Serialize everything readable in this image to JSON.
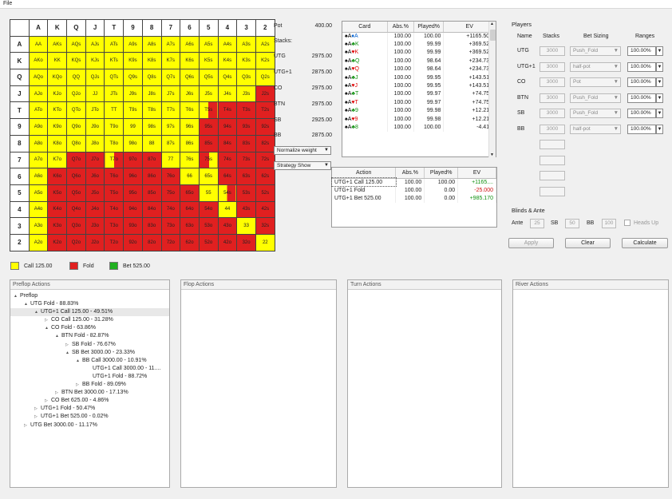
{
  "menu": {
    "file": "File"
  },
  "grid": {
    "col_headers": [
      "A",
      "K",
      "Q",
      "J",
      "T",
      "9",
      "8",
      "7",
      "6",
      "5",
      "4",
      "3",
      "2"
    ],
    "rows": [
      {
        "h": "A",
        "cells": [
          [
            "AA",
            "y"
          ],
          [
            "AKs",
            "y"
          ],
          [
            "AQs",
            "y"
          ],
          [
            "AJs",
            "y"
          ],
          [
            "ATs",
            "y"
          ],
          [
            "A9s",
            "y"
          ],
          [
            "A8s",
            "y"
          ],
          [
            "A7s",
            "y"
          ],
          [
            "A6s",
            "y"
          ],
          [
            "A5s",
            "y"
          ],
          [
            "A4s",
            "y"
          ],
          [
            "A3s",
            "y"
          ],
          [
            "A2s",
            "y"
          ]
        ]
      },
      {
        "h": "K",
        "cells": [
          [
            "AKo",
            "y"
          ],
          [
            "KK",
            "y"
          ],
          [
            "KQs",
            "y"
          ],
          [
            "KJs",
            "y"
          ],
          [
            "KTs",
            "y"
          ],
          [
            "K9s",
            "y"
          ],
          [
            "K8s",
            "y"
          ],
          [
            "K7s",
            "y"
          ],
          [
            "K6s",
            "y"
          ],
          [
            "K5s",
            "y"
          ],
          [
            "K4s",
            "y"
          ],
          [
            "K3s",
            "y"
          ],
          [
            "K2s",
            "y"
          ]
        ]
      },
      {
        "h": "Q",
        "cells": [
          [
            "AQo",
            "y"
          ],
          [
            "KQo",
            "y"
          ],
          [
            "QQ",
            "y"
          ],
          [
            "QJs",
            "y"
          ],
          [
            "QTs",
            "y"
          ],
          [
            "Q9s",
            "y"
          ],
          [
            "Q8s",
            "y"
          ],
          [
            "Q7s",
            "y"
          ],
          [
            "Q6s",
            "y"
          ],
          [
            "Q5s",
            "y"
          ],
          [
            "Q4s",
            "y"
          ],
          [
            "Q3s",
            "y"
          ],
          [
            "Q2s",
            "y"
          ]
        ]
      },
      {
        "h": "J",
        "cells": [
          [
            "AJo",
            "y"
          ],
          [
            "KJo",
            "y"
          ],
          [
            "QJo",
            "y"
          ],
          [
            "JJ",
            "y"
          ],
          [
            "JTs",
            "y"
          ],
          [
            "J9s",
            "y"
          ],
          [
            "J8s",
            "y"
          ],
          [
            "J7s",
            "y"
          ],
          [
            "J6s",
            "y"
          ],
          [
            "J5s",
            "y"
          ],
          [
            "J4s",
            "y"
          ],
          [
            "J3s",
            "y"
          ],
          [
            "J2s",
            "r"
          ]
        ]
      },
      {
        "h": "T",
        "cells": [
          [
            "ATo",
            "y"
          ],
          [
            "KTo",
            "y"
          ],
          [
            "QTo",
            "y"
          ],
          [
            "JTo",
            "y"
          ],
          [
            "TT",
            "y"
          ],
          [
            "T9s",
            "y"
          ],
          [
            "T8s",
            "y"
          ],
          [
            "T7s",
            "y"
          ],
          [
            "T6s",
            "y"
          ],
          [
            "T5s",
            "yr"
          ],
          [
            "T4s",
            "r"
          ],
          [
            "T3s",
            "r"
          ],
          [
            "T2s",
            "r"
          ]
        ]
      },
      {
        "h": "9",
        "cells": [
          [
            "A9o",
            "y"
          ],
          [
            "K9o",
            "y"
          ],
          [
            "Q9o",
            "y"
          ],
          [
            "J9o",
            "y"
          ],
          [
            "T9o",
            "y"
          ],
          [
            "99",
            "y"
          ],
          [
            "98s",
            "y"
          ],
          [
            "97s",
            "y"
          ],
          [
            "96s",
            "y"
          ],
          [
            "95s",
            "r"
          ],
          [
            "94s",
            "r"
          ],
          [
            "93s",
            "r"
          ],
          [
            "92s",
            "r"
          ]
        ]
      },
      {
        "h": "8",
        "cells": [
          [
            "A8o",
            "y"
          ],
          [
            "K8o",
            "y"
          ],
          [
            "Q8o",
            "y"
          ],
          [
            "J8o",
            "y"
          ],
          [
            "T8o",
            "y"
          ],
          [
            "98o",
            "y"
          ],
          [
            "88",
            "y"
          ],
          [
            "87s",
            "y"
          ],
          [
            "86s",
            "y"
          ],
          [
            "85s",
            "r"
          ],
          [
            "84s",
            "r"
          ],
          [
            "83s",
            "r"
          ],
          [
            "82s",
            "r"
          ]
        ]
      },
      {
        "h": "7",
        "cells": [
          [
            "A7o",
            "y"
          ],
          [
            "K7o",
            "y"
          ],
          [
            "Q7o",
            "r"
          ],
          [
            "J7o",
            "r"
          ],
          [
            "T7o",
            "yr"
          ],
          [
            "97o",
            "r"
          ],
          [
            "87o",
            "r"
          ],
          [
            "77",
            "y"
          ],
          [
            "76s",
            "y"
          ],
          [
            "75s",
            "ry"
          ],
          [
            "74s",
            "r"
          ],
          [
            "73s",
            "r"
          ],
          [
            "72s",
            "r"
          ]
        ]
      },
      {
        "h": "6",
        "cells": [
          [
            "A6o",
            "y"
          ],
          [
            "K6o",
            "r"
          ],
          [
            "Q6o",
            "r"
          ],
          [
            "J6o",
            "r"
          ],
          [
            "T6o",
            "r"
          ],
          [
            "96o",
            "r"
          ],
          [
            "86o",
            "r"
          ],
          [
            "76o",
            "r"
          ],
          [
            "66",
            "y"
          ],
          [
            "65s",
            "y"
          ],
          [
            "64s",
            "r"
          ],
          [
            "63s",
            "r"
          ],
          [
            "62s",
            "r"
          ]
        ]
      },
      {
        "h": "5",
        "cells": [
          [
            "A5o",
            "y"
          ],
          [
            "K5o",
            "r"
          ],
          [
            "Q5o",
            "r"
          ],
          [
            "J5o",
            "r"
          ],
          [
            "T5o",
            "r"
          ],
          [
            "95o",
            "r"
          ],
          [
            "85o",
            "r"
          ],
          [
            "75o",
            "r"
          ],
          [
            "65o",
            "r"
          ],
          [
            "55",
            "y"
          ],
          [
            "54s",
            "yr"
          ],
          [
            "53s",
            "r"
          ],
          [
            "52s",
            "r"
          ]
        ]
      },
      {
        "h": "4",
        "cells": [
          [
            "A4o",
            "y"
          ],
          [
            "K4o",
            "r"
          ],
          [
            "Q4o",
            "r"
          ],
          [
            "J4o",
            "r"
          ],
          [
            "T4o",
            "r"
          ],
          [
            "94o",
            "r"
          ],
          [
            "84o",
            "r"
          ],
          [
            "74o",
            "r"
          ],
          [
            "64o",
            "r"
          ],
          [
            "54o",
            "r"
          ],
          [
            "44",
            "y"
          ],
          [
            "43s",
            "r"
          ],
          [
            "42s",
            "r"
          ]
        ]
      },
      {
        "h": "3",
        "cells": [
          [
            "A3o",
            "y"
          ],
          [
            "K3o",
            "r"
          ],
          [
            "Q3o",
            "r"
          ],
          [
            "J3o",
            "r"
          ],
          [
            "T3o",
            "r"
          ],
          [
            "93o",
            "r"
          ],
          [
            "83o",
            "r"
          ],
          [
            "73o",
            "r"
          ],
          [
            "63o",
            "r"
          ],
          [
            "53o",
            "r"
          ],
          [
            "43o",
            "r"
          ],
          [
            "33",
            "y"
          ],
          [
            "32s",
            "r"
          ]
        ]
      },
      {
        "h": "2",
        "cells": [
          [
            "A2o",
            "y"
          ],
          [
            "K2o",
            "r"
          ],
          [
            "Q2o",
            "r"
          ],
          [
            "J2o",
            "r"
          ],
          [
            "T2o",
            "r"
          ],
          [
            "92o",
            "r"
          ],
          [
            "82o",
            "r"
          ],
          [
            "72o",
            "r"
          ],
          [
            "62o",
            "r"
          ],
          [
            "52o",
            "r"
          ],
          [
            "42o",
            "r"
          ],
          [
            "32o",
            "r"
          ],
          [
            "22",
            "y"
          ]
        ]
      }
    ]
  },
  "legend": [
    {
      "label": "Call 125.00",
      "color": "#ffff00"
    },
    {
      "label": "Fold",
      "color": "#e02020"
    },
    {
      "label": "Bet 525.00",
      "color": "#20b020"
    }
  ],
  "pot": {
    "label": "Pot",
    "value": "400.00"
  },
  "stacks": {
    "label": "Stacks:",
    "items": [
      {
        "pos": "UTG",
        "value": "2975.00"
      },
      {
        "pos": "UTG+1",
        "value": "2875.00"
      },
      {
        "pos": "CO",
        "value": "2975.00"
      },
      {
        "pos": "BTN",
        "value": "2975.00"
      },
      {
        "pos": "SB",
        "value": "2925.00"
      },
      {
        "pos": "BB",
        "value": "2875.00"
      }
    ]
  },
  "dropdowns": {
    "weight": "Normalize weight",
    "strategy": "Strategy Show"
  },
  "cards_table": {
    "headers": [
      "Card",
      "Abs.%",
      "Played%",
      "EV"
    ],
    "rows": [
      {
        "c1": "♠A",
        "s1": "s",
        "c2": "♦A",
        "s2": "d",
        "abs": "100.00",
        "played": "100.00",
        "ev": "+1165.505"
      },
      {
        "c1": "♠A",
        "s1": "s",
        "c2": "♣K",
        "s2": "c",
        "abs": "100.00",
        "played": "99.99",
        "ev": "+369.525"
      },
      {
        "c1": "♠A",
        "s1": "s",
        "c2": "♥K",
        "s2": "h",
        "abs": "100.00",
        "played": "99.99",
        "ev": "+369.525"
      },
      {
        "c1": "♠A",
        "s1": "s",
        "c2": "♣Q",
        "s2": "c",
        "abs": "100.00",
        "played": "98.64",
        "ev": "+234.733"
      },
      {
        "c1": "♠A",
        "s1": "s",
        "c2": "♥Q",
        "s2": "h",
        "abs": "100.00",
        "played": "98.64",
        "ev": "+234.733"
      },
      {
        "c1": "♠A",
        "s1": "s",
        "c2": "♣J",
        "s2": "c",
        "abs": "100.00",
        "played": "99.95",
        "ev": "+143.518"
      },
      {
        "c1": "♠A",
        "s1": "s",
        "c2": "♥J",
        "s2": "h",
        "abs": "100.00",
        "played": "99.95",
        "ev": "+143.518"
      },
      {
        "c1": "♠A",
        "s1": "s",
        "c2": "♣T",
        "s2": "c",
        "abs": "100.00",
        "played": "99.97",
        "ev": "+74.757"
      },
      {
        "c1": "♠A",
        "s1": "s",
        "c2": "♥T",
        "s2": "h",
        "abs": "100.00",
        "played": "99.97",
        "ev": "+74.757"
      },
      {
        "c1": "♠A",
        "s1": "s",
        "c2": "♣9",
        "s2": "c",
        "abs": "100.00",
        "played": "99.98",
        "ev": "+12.217"
      },
      {
        "c1": "♠A",
        "s1": "s",
        "c2": "♥9",
        "s2": "h",
        "abs": "100.00",
        "played": "99.98",
        "ev": "+12.217"
      },
      {
        "c1": "♠A",
        "s1": "s",
        "c2": "♣8",
        "s2": "c",
        "abs": "100.00",
        "played": "100.00",
        "ev": "-4.412"
      }
    ]
  },
  "action_table": {
    "headers": [
      "Action",
      "Abs.%",
      "Played%",
      "EV"
    ],
    "rows": [
      {
        "action": "UTG+1 Call 125.00",
        "abs": "100.00",
        "played": "100.00",
        "ev": "+1165....",
        "cls": "pos"
      },
      {
        "action": "UTG+1 Fold",
        "abs": "100.00",
        "played": "0.00",
        "ev": "-25.000",
        "cls": "neg"
      },
      {
        "action": "UTG+1 Bet 525.00",
        "abs": "100.00",
        "played": "0.00",
        "ev": "+985.170",
        "cls": "pos"
      }
    ]
  },
  "players": {
    "title": "Players",
    "headers": [
      "Name",
      "Stacks",
      "Bet Sizing",
      "Ranges"
    ],
    "rows": [
      {
        "name": "UTG",
        "stack": "3000",
        "sizing": "Push_Fold",
        "range": "100.00%"
      },
      {
        "name": "UTG+1",
        "stack": "3000",
        "sizing": "half-pot",
        "range": "100.00%"
      },
      {
        "name": "CO",
        "stack": "3000",
        "sizing": "Pot",
        "range": "100.00%"
      },
      {
        "name": "BTN",
        "stack": "3000",
        "sizing": "Push_Fold",
        "range": "100.00%"
      },
      {
        "name": "SB",
        "stack": "3000",
        "sizing": "Push_Fold",
        "range": "100.00%"
      },
      {
        "name": "BB",
        "stack": "3000",
        "sizing": "half-pot",
        "range": "100.00%"
      }
    ]
  },
  "blinds": {
    "title": "Blinds & Ante",
    "ante_label": "Ante",
    "ante": "25",
    "sb_label": "SB",
    "sb": "50",
    "bb_label": "BB",
    "bb": "100",
    "headsup": "Heads Up"
  },
  "buttons": {
    "apply": "Apply",
    "clear": "Clear",
    "calculate": "Calculate"
  },
  "panels": {
    "preflop": "Preflop Actions",
    "flop": "Flop Actions",
    "turn": "Turn Actions",
    "river": "River Actions"
  },
  "tree": [
    {
      "d": 0,
      "t": "▲",
      "label": "Preflop"
    },
    {
      "d": 1,
      "t": "▲",
      "label": "UTG Fold - 88.83%"
    },
    {
      "d": 2,
      "t": "▲",
      "label": "UTG+1 Call 125.00 - 49.51%",
      "sel": true
    },
    {
      "d": 3,
      "t": "▷",
      "label": "CO Call 125.00 - 31.28%"
    },
    {
      "d": 3,
      "t": "▲",
      "label": "CO Fold - 63.86%"
    },
    {
      "d": 4,
      "t": "▲",
      "label": "BTN Fold - 82.87%"
    },
    {
      "d": 5,
      "t": "▷",
      "label": "SB Fold - 76.67%"
    },
    {
      "d": 5,
      "t": "▲",
      "label": "SB Bet 3000.00 - 23.33%"
    },
    {
      "d": 6,
      "t": "▲",
      "label": "BB Call 3000.00 - 10.91%"
    },
    {
      "d": 7,
      "t": "",
      "label": "UTG+1 Call 3000.00 - 11...."
    },
    {
      "d": 7,
      "t": "",
      "label": "UTG+1 Fold - 88.72%"
    },
    {
      "d": 6,
      "t": "▷",
      "label": "BB Fold - 89.09%"
    },
    {
      "d": 4,
      "t": "▷",
      "label": "BTN Bet 3000.00 - 17.13%"
    },
    {
      "d": 3,
      "t": "▷",
      "label": "CO Bet 625.00 - 4.86%"
    },
    {
      "d": 2,
      "t": "▷",
      "label": "UTG+1 Fold - 50.47%"
    },
    {
      "d": 2,
      "t": "▷",
      "label": "UTG+1 Bet 525.00 - 0.02%"
    },
    {
      "d": 1,
      "t": "▷",
      "label": "UTG Bet 3000.00 - 11.17%"
    }
  ],
  "icons": {
    "dropdown": "chevron-down-icon",
    "expand": "triangle-icon"
  }
}
